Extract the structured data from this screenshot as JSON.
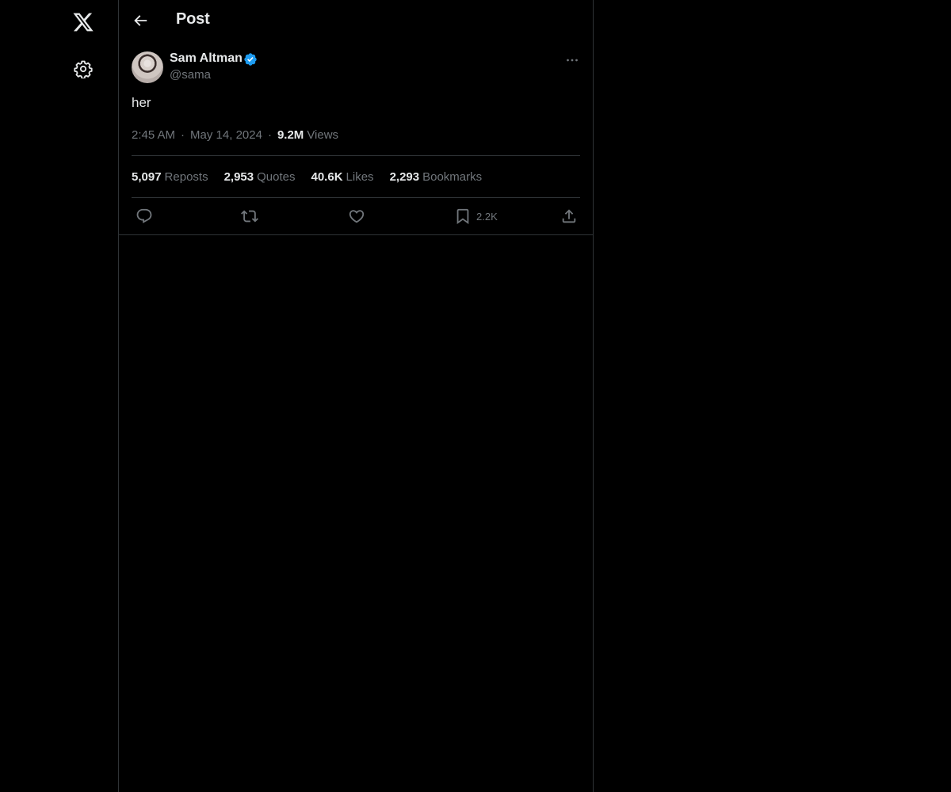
{
  "nav": {
    "logo_icon": "x-logo-icon",
    "settings_icon": "gear-icon"
  },
  "header": {
    "title": "Post",
    "back_icon": "arrow-left-icon"
  },
  "post": {
    "author_name": "Sam Altman",
    "handle": "@sama",
    "verified": true,
    "text": "her",
    "time": "2:45 AM",
    "separator": "·",
    "date": "May 14, 2024",
    "views_count": "9.2M",
    "views_label": "Views"
  },
  "stats": [
    {
      "num": "5,097",
      "label": "Reposts"
    },
    {
      "num": "2,953",
      "label": "Quotes"
    },
    {
      "num": "40.6K",
      "label": "Likes"
    },
    {
      "num": "2,293",
      "label": "Bookmarks"
    }
  ],
  "actions": {
    "reply_icon": "reply-icon",
    "repost_icon": "repost-icon",
    "like_icon": "heart-icon",
    "bookmark_icon": "bookmark-icon",
    "bookmark_count": "2.2K",
    "share_icon": "share-icon"
  },
  "colors": {
    "background": "#000000",
    "text": "#e7e9ea",
    "muted": "#71767b",
    "border": "#2f3336",
    "verified": "#1d9bf0"
  }
}
